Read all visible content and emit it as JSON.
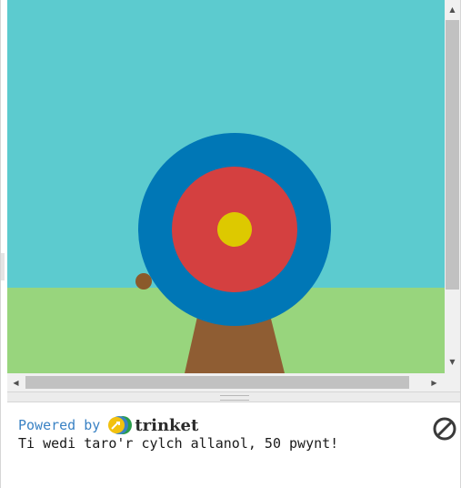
{
  "scene": {
    "sky_color": "#5ccbcf",
    "grass_color": "#98d57d",
    "stand_color": "#8f5d33",
    "ring_outer_color": "#0077b6",
    "ring_middle_color": "#d44040",
    "bullseye_color": "#ddc900",
    "arrow_color": "#8b5a2b"
  },
  "console": {
    "powered_by": "Powered by",
    "brand": "trinket",
    "output": "Ti wedi taro'r cylch allanol, 50 pwynt!"
  },
  "icons": {
    "stop": "stop-icon",
    "logo": "trinket-logo-icon"
  }
}
